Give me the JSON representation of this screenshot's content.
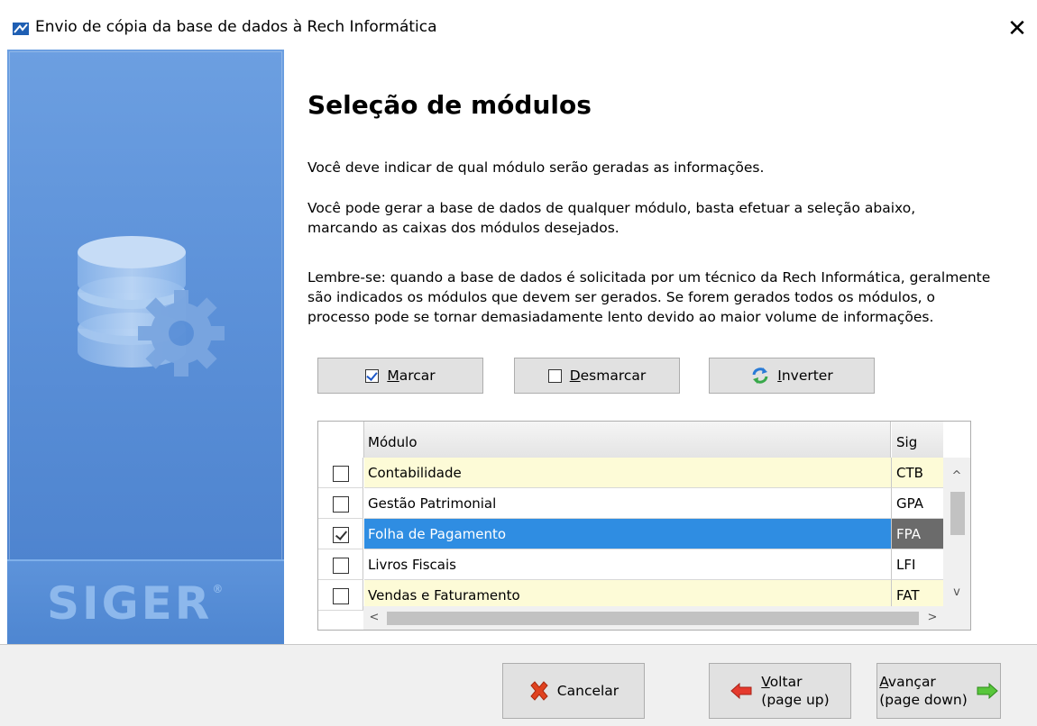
{
  "window": {
    "title": "Envio de cópia da base de dados à Rech Informática",
    "close_glyph": "✕",
    "app_icon": "rech-app-icon"
  },
  "left_panel": {
    "logo_text": "SIGER",
    "logo_mark": "®",
    "graphic": "database-gear-icon"
  },
  "content": {
    "heading": "Seleção de módulos",
    "paragraph1": "Você deve indicar de qual módulo serão geradas as informações.",
    "paragraph2_line1": "Você pode gerar a base de dados de qualquer módulo, basta efetuar a seleção abaixo,",
    "paragraph2_line2": "marcando as caixas dos módulos desejados.",
    "paragraph3_line1": "Lembre-se: quando a base de dados é solicitada por um técnico da Rech Informática, geralmente",
    "paragraph3_line2": "são indicados os módulos que devem ser gerados. Se forem gerados todos os módulos, o",
    "paragraph3_line3": "processo pode se tornar demasiadamente lento devido ao maior volume de informações."
  },
  "actions": {
    "mark_key": "M",
    "mark_rest": "arcar",
    "unmark_key": "D",
    "unmark_rest": "esmarcar",
    "invert_key": "I",
    "invert_rest": "nverter"
  },
  "grid": {
    "columns": {
      "module": "Módulo",
      "sig": "Sig"
    },
    "rows": [
      {
        "module": "Contabilidade",
        "sig": "CTB",
        "checked": false,
        "style": "yellow"
      },
      {
        "module": "Gestão Patrimonial",
        "sig": "GPA",
        "checked": false,
        "style": "white"
      },
      {
        "module": "Folha de Pagamento",
        "sig": "FPA",
        "checked": true,
        "style": "selected"
      },
      {
        "module": "Livros Fiscais",
        "sig": "LFI",
        "checked": false,
        "style": "white"
      },
      {
        "module": "Vendas e Faturamento",
        "sig": "FAT",
        "checked": false,
        "style": "yellow"
      }
    ],
    "scroll_up": "^",
    "scroll_down": "v",
    "scroll_left": "<",
    "scroll_right": ">"
  },
  "footer": {
    "cancel_label": "Cancelar",
    "back_key": "V",
    "back_rest": "oltar",
    "back_hint": "(page up)",
    "next_key": "A",
    "next_rest": "vançar",
    "next_hint": "(page down)"
  },
  "colors": {
    "panel_blue": "#5b90d8",
    "selection_blue": "#2f8de2",
    "row_yellow": "#fdfbd7"
  }
}
